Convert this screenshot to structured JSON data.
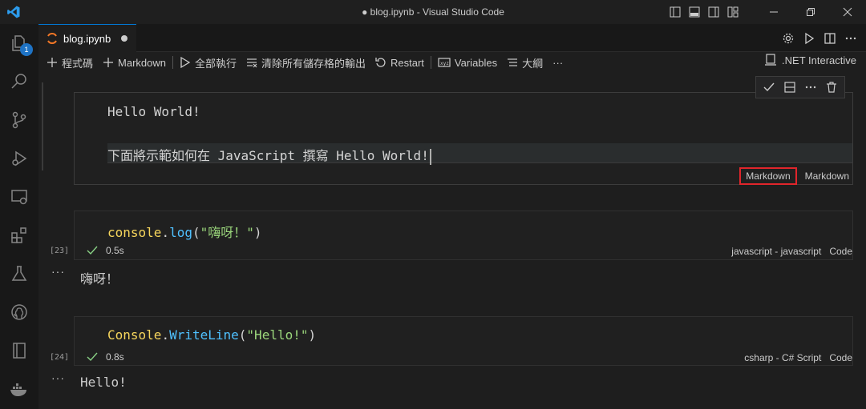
{
  "window": {
    "title": "● blog.ipynb - Visual Studio Code"
  },
  "activity": {
    "explorer_badge": "1"
  },
  "tab": {
    "label": "blog.ipynb"
  },
  "toolbar": {
    "add_code": "程式碼",
    "add_markdown": "Markdown",
    "run_all": "全部執行",
    "clear_outputs": "清除所有儲存格的輸出",
    "restart": "Restart",
    "variables": "Variables",
    "outline": "大綱",
    "more": "···",
    "kernel": ".NET Interactive"
  },
  "cells": {
    "md": {
      "line1": "Hello World!",
      "line2": "下面將示範如何在 JavaScript 撰寫 Hello World!",
      "lang_label": "Markdown",
      "type_label": "Markdown"
    },
    "js": {
      "code_obj": "console",
      "code_dot": ".",
      "code_fn": "log",
      "code_open": "(",
      "code_str": "\"嗨呀！\"",
      "code_close": ")",
      "exec_count": "[23]",
      "duration": "0.5s",
      "lang_label": "javascript - javascript",
      "type_label": "Code",
      "output": "嗨呀！"
    },
    "cs": {
      "code_obj": "Console",
      "code_dot": ".",
      "code_fn": "WriteLine",
      "code_open": "(",
      "code_str": "\"Hello!\"",
      "code_close": ")",
      "exec_count": "[24]",
      "duration": "0.8s",
      "lang_label": "csharp - C# Script",
      "type_label": "Code",
      "output": "Hello!"
    }
  },
  "output_more": "···"
}
